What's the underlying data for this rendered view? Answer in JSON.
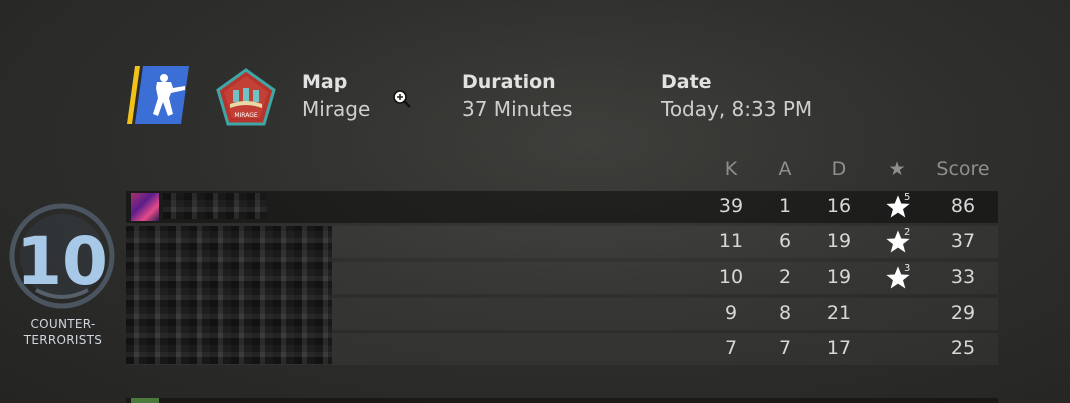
{
  "match": {
    "map_label": "Map",
    "map_value": "Mirage",
    "duration_label": "Duration",
    "duration_value": "37 Minutes",
    "date_label": "Date",
    "date_value": "Today, 8:33 PM",
    "map_emblem_text": "MIRAGE"
  },
  "team": {
    "score": "10",
    "name_line1": "COUNTER-",
    "name_line2": "TERRORISTS",
    "color": "#a8c8e8"
  },
  "columns": {
    "k": "K",
    "a": "A",
    "d": "D",
    "mvp": "★",
    "score": "Score"
  },
  "players": [
    {
      "k": "39",
      "a": "1",
      "d": "16",
      "mvp": "5",
      "score": "86"
    },
    {
      "k": "11",
      "a": "6",
      "d": "19",
      "mvp": "2",
      "score": "37"
    },
    {
      "k": "10",
      "a": "2",
      "d": "19",
      "mvp": "3",
      "score": "33"
    },
    {
      "k": "9",
      "a": "8",
      "d": "21",
      "mvp": "",
      "score": "29"
    },
    {
      "k": "7",
      "a": "7",
      "d": "17",
      "mvp": "",
      "score": "25"
    }
  ],
  "icons": {
    "ct_badge": "counter-terrorist-icon",
    "map": "mirage-map-icon",
    "cursor": "zoom-in-cursor-icon",
    "mvp_star": "star-icon"
  }
}
